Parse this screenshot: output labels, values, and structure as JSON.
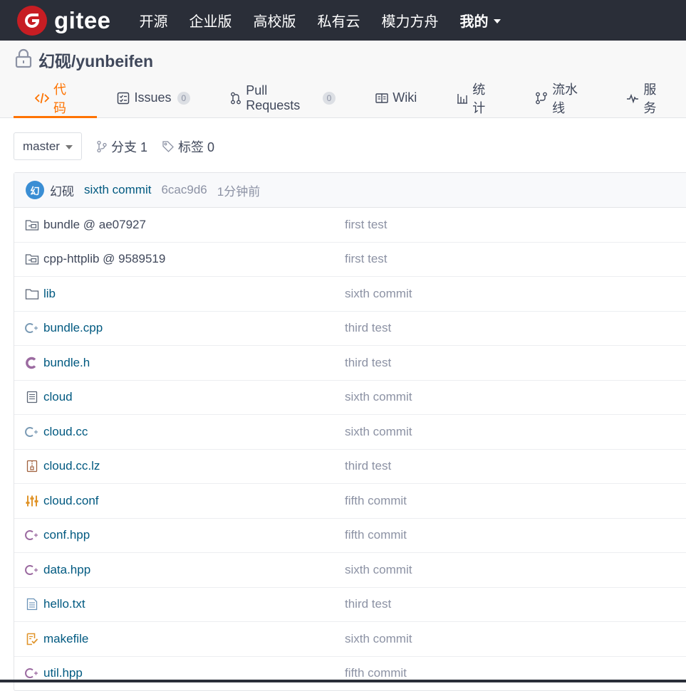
{
  "navbar": {
    "logo_text": "gitee",
    "items": [
      "开源",
      "企业版",
      "高校版",
      "私有云",
      "模力方舟"
    ],
    "mine_label": "我的"
  },
  "repo": {
    "title": "幻砚/yunbeifen",
    "tabs": [
      {
        "label": "代码",
        "icon": "code-icon",
        "active": true
      },
      {
        "label": "Issues",
        "count": "0",
        "icon": "issues-icon"
      },
      {
        "label": "Pull Requests",
        "count": "0",
        "icon": "pull-request-icon"
      },
      {
        "label": "Wiki",
        "icon": "wiki-icon"
      },
      {
        "label": "统计",
        "icon": "stats-icon"
      },
      {
        "label": "流水线",
        "icon": "pipeline-icon"
      },
      {
        "label": "服务",
        "icon": "service-icon"
      }
    ]
  },
  "branch_bar": {
    "branch": "master",
    "branches_label": "分支 1",
    "tags_label": "标签 0"
  },
  "latest_commit": {
    "avatar_char": "幻",
    "author": "幻砚",
    "message": "sixth commit",
    "sha": "6cac9d6",
    "time": "1分钟前"
  },
  "files": [
    {
      "name": "bundle @ ae07927",
      "commit": "first test",
      "icon": "submodule-icon"
    },
    {
      "name": "cpp-httplib @ 9589519",
      "commit": "first test",
      "icon": "submodule-icon"
    },
    {
      "name": "lib",
      "commit": "sixth commit",
      "icon": "folder-icon"
    },
    {
      "name": "bundle.cpp",
      "commit": "third test",
      "icon": "cpp-file-icon"
    },
    {
      "name": "bundle.h",
      "commit": "third test",
      "icon": "c-header-file-icon"
    },
    {
      "name": "cloud",
      "commit": "sixth commit",
      "icon": "binary-file-icon"
    },
    {
      "name": "cloud.cc",
      "commit": "sixth commit",
      "icon": "cpp-file-icon"
    },
    {
      "name": "cloud.cc.lz",
      "commit": "third test",
      "icon": "archive-file-icon"
    },
    {
      "name": "cloud.conf",
      "commit": "fifth commit",
      "icon": "config-file-icon"
    },
    {
      "name": "conf.hpp",
      "commit": "fifth commit",
      "icon": "hpp-file-icon"
    },
    {
      "name": "data.hpp",
      "commit": "sixth commit",
      "icon": "hpp-file-icon"
    },
    {
      "name": "hello.txt",
      "commit": "third test",
      "icon": "text-file-icon"
    },
    {
      "name": "makefile",
      "commit": "sixth commit",
      "icon": "makefile-icon"
    },
    {
      "name": "util.hpp",
      "commit": "fifth commit",
      "icon": "hpp-file-icon"
    }
  ],
  "colors": {
    "brand_red": "#c71d23",
    "accent_orange": "#fe7300",
    "link_blue": "#005980",
    "navbar_bg": "#2a2e38"
  }
}
